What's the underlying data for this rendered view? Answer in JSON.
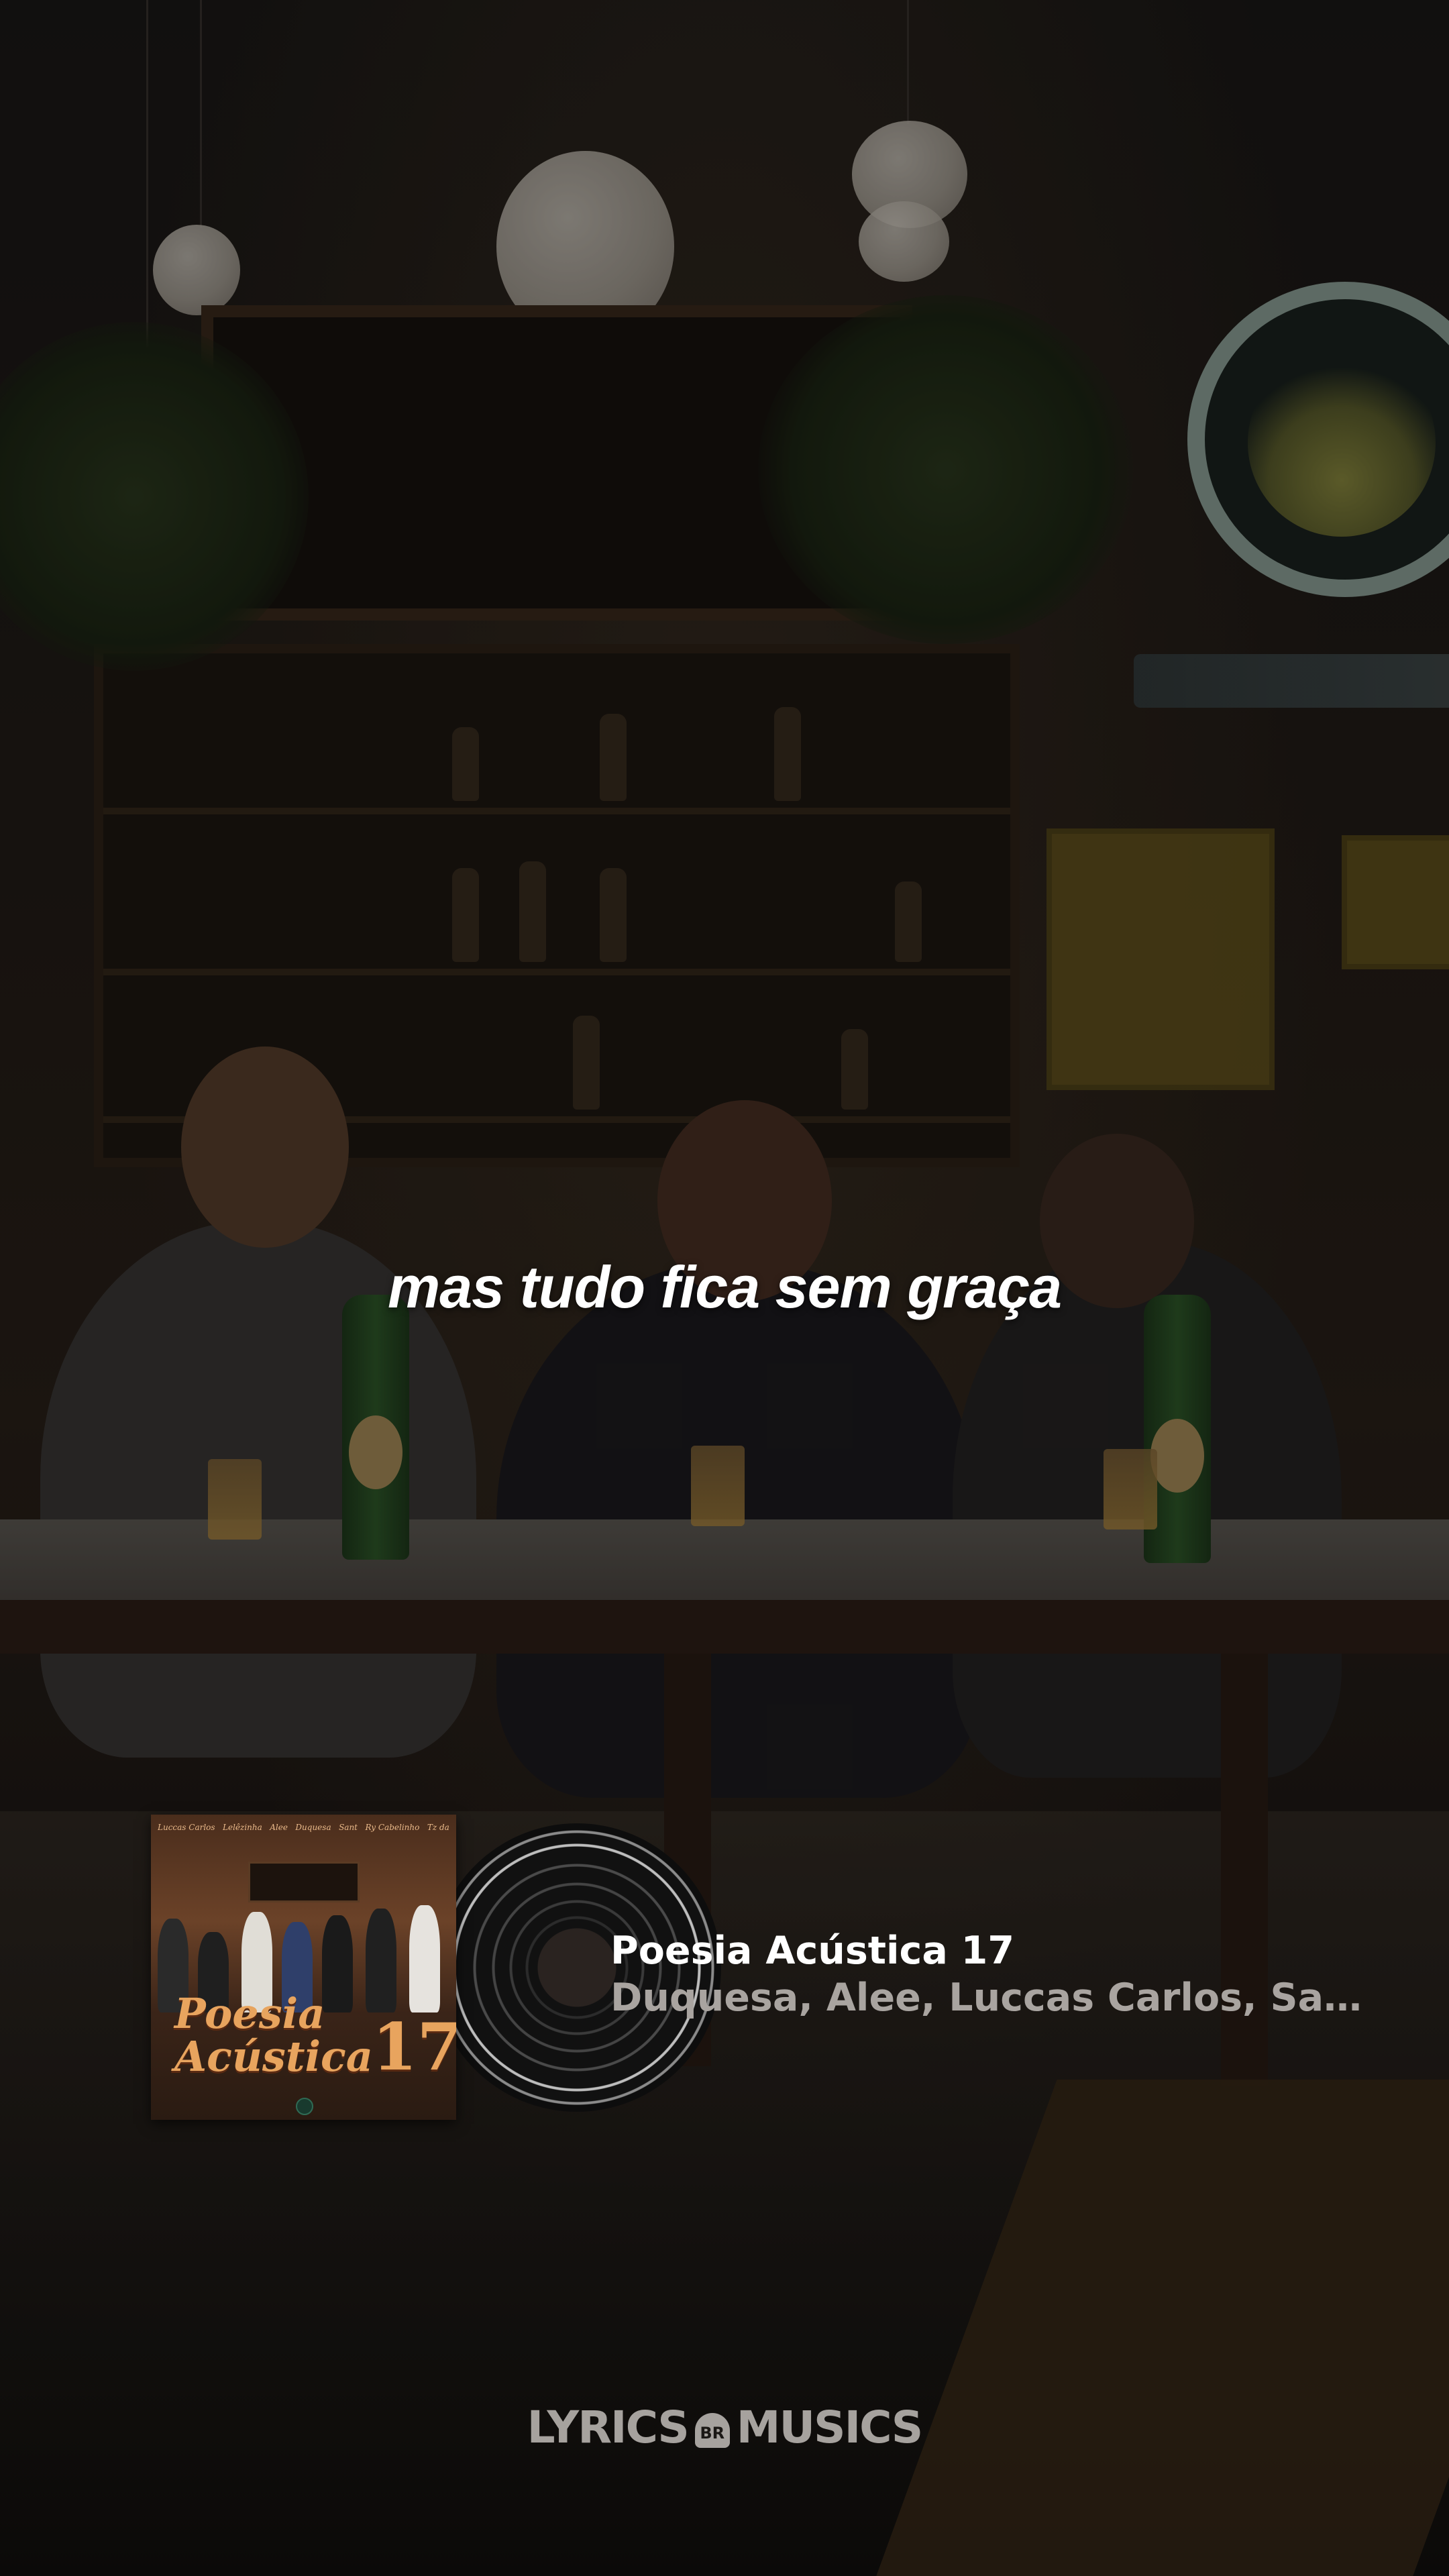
{
  "lyrics": {
    "current_line": "mas tudo fica sem graça"
  },
  "now_playing": {
    "album_art": {
      "artist_names": [
        "Luccas Carlos",
        "Lelêzinha",
        "Alee",
        "Duquesa",
        "Sant",
        "Ry Cabelinho",
        "Tz da Coronel"
      ],
      "title": "Poesia Acústica",
      "number": "17"
    },
    "track_title": "Poesia Acústica 17",
    "artists": "Duquesa, Alee, Luccas Carlos, Sant..."
  },
  "branding": {
    "left": "LYRICS",
    "badge": "BR",
    "right": "MUSICS"
  },
  "colors": {
    "accent_title": "#e8a45e",
    "text_primary": "#ffffff",
    "text_secondary": "#a9a4a0"
  }
}
